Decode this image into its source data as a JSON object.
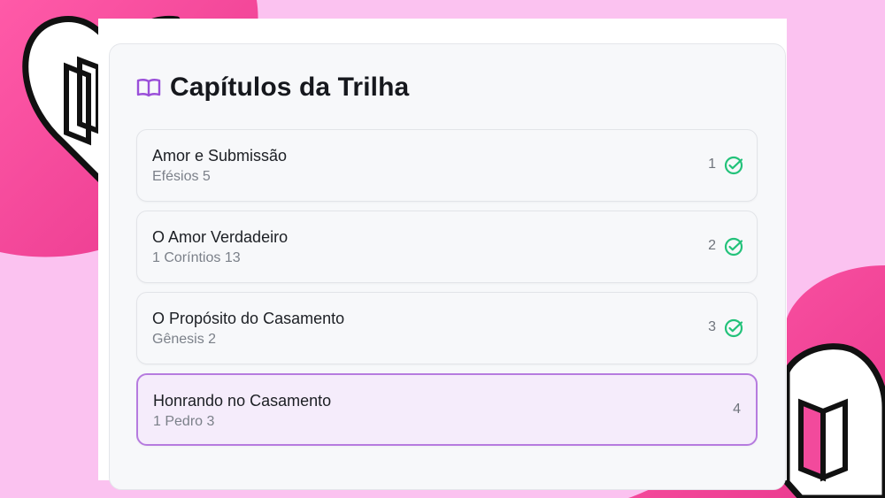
{
  "header": {
    "title": "Capítulos da Trilha",
    "icon": "open-book-icon",
    "icon_color": "#9a4fd9"
  },
  "chapters": [
    {
      "title": "Amor e Submissão",
      "reference": "Efésios 5",
      "number": "1",
      "completed": true
    },
    {
      "title": "O Amor Verdadeiro",
      "reference": "1 Coríntios 13",
      "number": "2",
      "completed": true
    },
    {
      "title": "O Propósito do Casamento",
      "reference": "Gênesis 2",
      "number": "3",
      "completed": true
    },
    {
      "title": "Honrando no Casamento",
      "reference": "1 Pedro 3",
      "number": "4",
      "completed": false,
      "active": true
    }
  ],
  "colors": {
    "background": "#fbc2f0",
    "accent_pink": "#f24a9c",
    "check_green": "#23c27a",
    "active_border": "#b67bdf",
    "active_fill": "#f5ecfb"
  },
  "decorations": [
    "heart-book-icon",
    "heart-book-icon"
  ]
}
